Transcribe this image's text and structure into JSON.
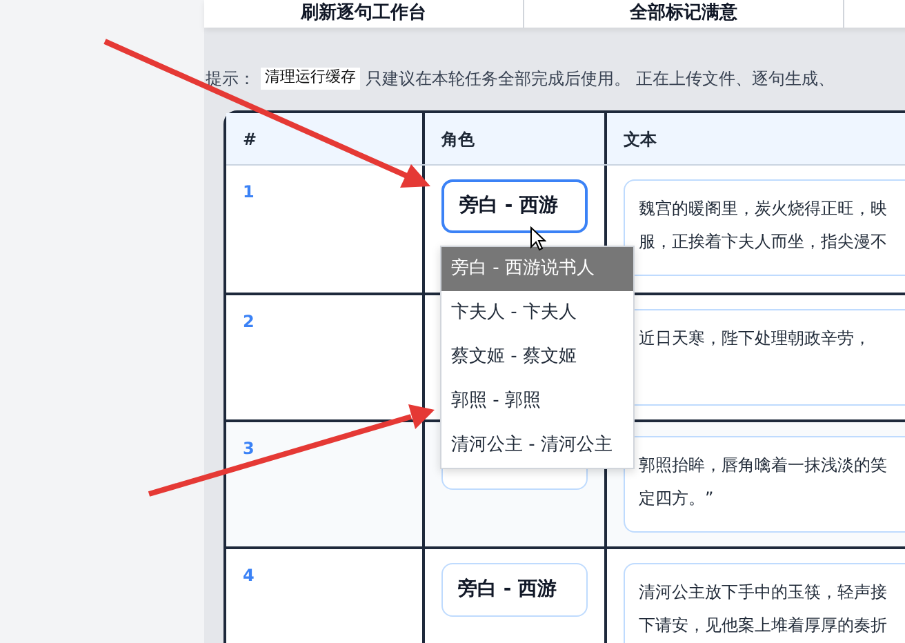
{
  "toolbar": {
    "buttons": [
      "刷新逐句工作台",
      "全部标记满意"
    ]
  },
  "hint": {
    "label": "提示：",
    "code": "清理运行缓存",
    "text": "只建议在本轮任务全部完成后使用。 正在上传文件、逐句生成、"
  },
  "table": {
    "columns": [
      "#",
      "角色",
      "文本"
    ],
    "rows": [
      {
        "index": "1",
        "role": "旁白 - 西游",
        "focused": true,
        "lines": [
          "魏宫的暖阁里，炭火烧得正旺，映",
          "服，正挨着卞夫人而坐，指尖漫不"
        ]
      },
      {
        "index": "2",
        "lines": [
          "近日天寒，陛下处理朝政辛劳，"
        ]
      },
      {
        "index": "3",
        "lines": [
          "郭照抬眸，唇角噙着一抹浅淡的笑",
          "定四方。”"
        ]
      },
      {
        "index": "4",
        "role": "旁白 - 西游",
        "focused": false,
        "lines": [
          "清河公主放下手中的玉筷，轻声接",
          "下请安，见他案上堆着厚厚的奏折"
        ]
      }
    ]
  },
  "dropdown": {
    "options": [
      {
        "label": "旁白 - 西游说书人",
        "selected": true
      },
      {
        "label": "卞夫人 - 卞夫人",
        "selected": false
      },
      {
        "label": "蔡文姬 - 蔡文姬",
        "selected": false
      },
      {
        "label": "郭照 - 郭照",
        "selected": false
      },
      {
        "label": "清河公主 - 清河公主",
        "selected": false
      }
    ]
  }
}
